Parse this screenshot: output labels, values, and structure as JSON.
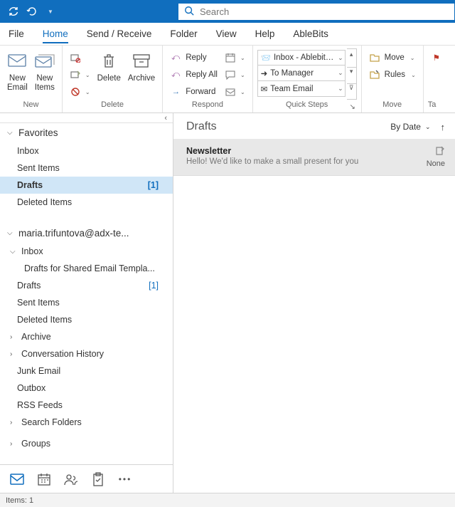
{
  "search": {
    "placeholder": "Search"
  },
  "menubar": [
    "File",
    "Home",
    "Send / Receive",
    "Folder",
    "View",
    "Help",
    "AbleBits"
  ],
  "menubar_active": 1,
  "ribbon": {
    "new": {
      "label": "New",
      "new_email": "New\nEmail",
      "new_items": "New\nItems"
    },
    "delete": {
      "label": "Delete",
      "delete_btn": "Delete",
      "archive_btn": "Archive"
    },
    "respond": {
      "label": "Respond",
      "reply": "Reply",
      "reply_all": "Reply All",
      "forward": "Forward"
    },
    "quick_steps": {
      "label": "Quick Steps",
      "items": [
        "Inbox - Ablebits...",
        "To Manager",
        "Team Email"
      ]
    },
    "move": {
      "label": "Move",
      "move_btn": "Move",
      "rules_btn": "Rules"
    },
    "tags": {
      "label": "Ta"
    }
  },
  "nav": {
    "favorites": {
      "title": "Favorites",
      "items": [
        {
          "label": "Inbox",
          "count": null
        },
        {
          "label": "Sent Items",
          "count": null
        },
        {
          "label": "Drafts",
          "count": "[1]",
          "selected": true
        },
        {
          "label": "Deleted Items",
          "count": null
        }
      ]
    },
    "account": {
      "title": "maria.trifuntova@adx-te...",
      "inbox": "Inbox",
      "inbox_sub": "Drafts for Shared Email Templa...",
      "drafts": {
        "label": "Drafts",
        "count": "[1]"
      },
      "sent": "Sent Items",
      "deleted": "Deleted Items",
      "archive": "Archive",
      "conv": "Conversation History",
      "junk": "Junk Email",
      "outbox": "Outbox",
      "rss": "RSS Feeds",
      "search": "Search Folders",
      "groups": "Groups"
    }
  },
  "list": {
    "title": "Drafts",
    "sort": "By Date",
    "messages": [
      {
        "subject": "Newsletter",
        "preview": "Hello!  We'd like to make a small present for you",
        "date": "None"
      }
    ]
  },
  "status": "Items: 1"
}
